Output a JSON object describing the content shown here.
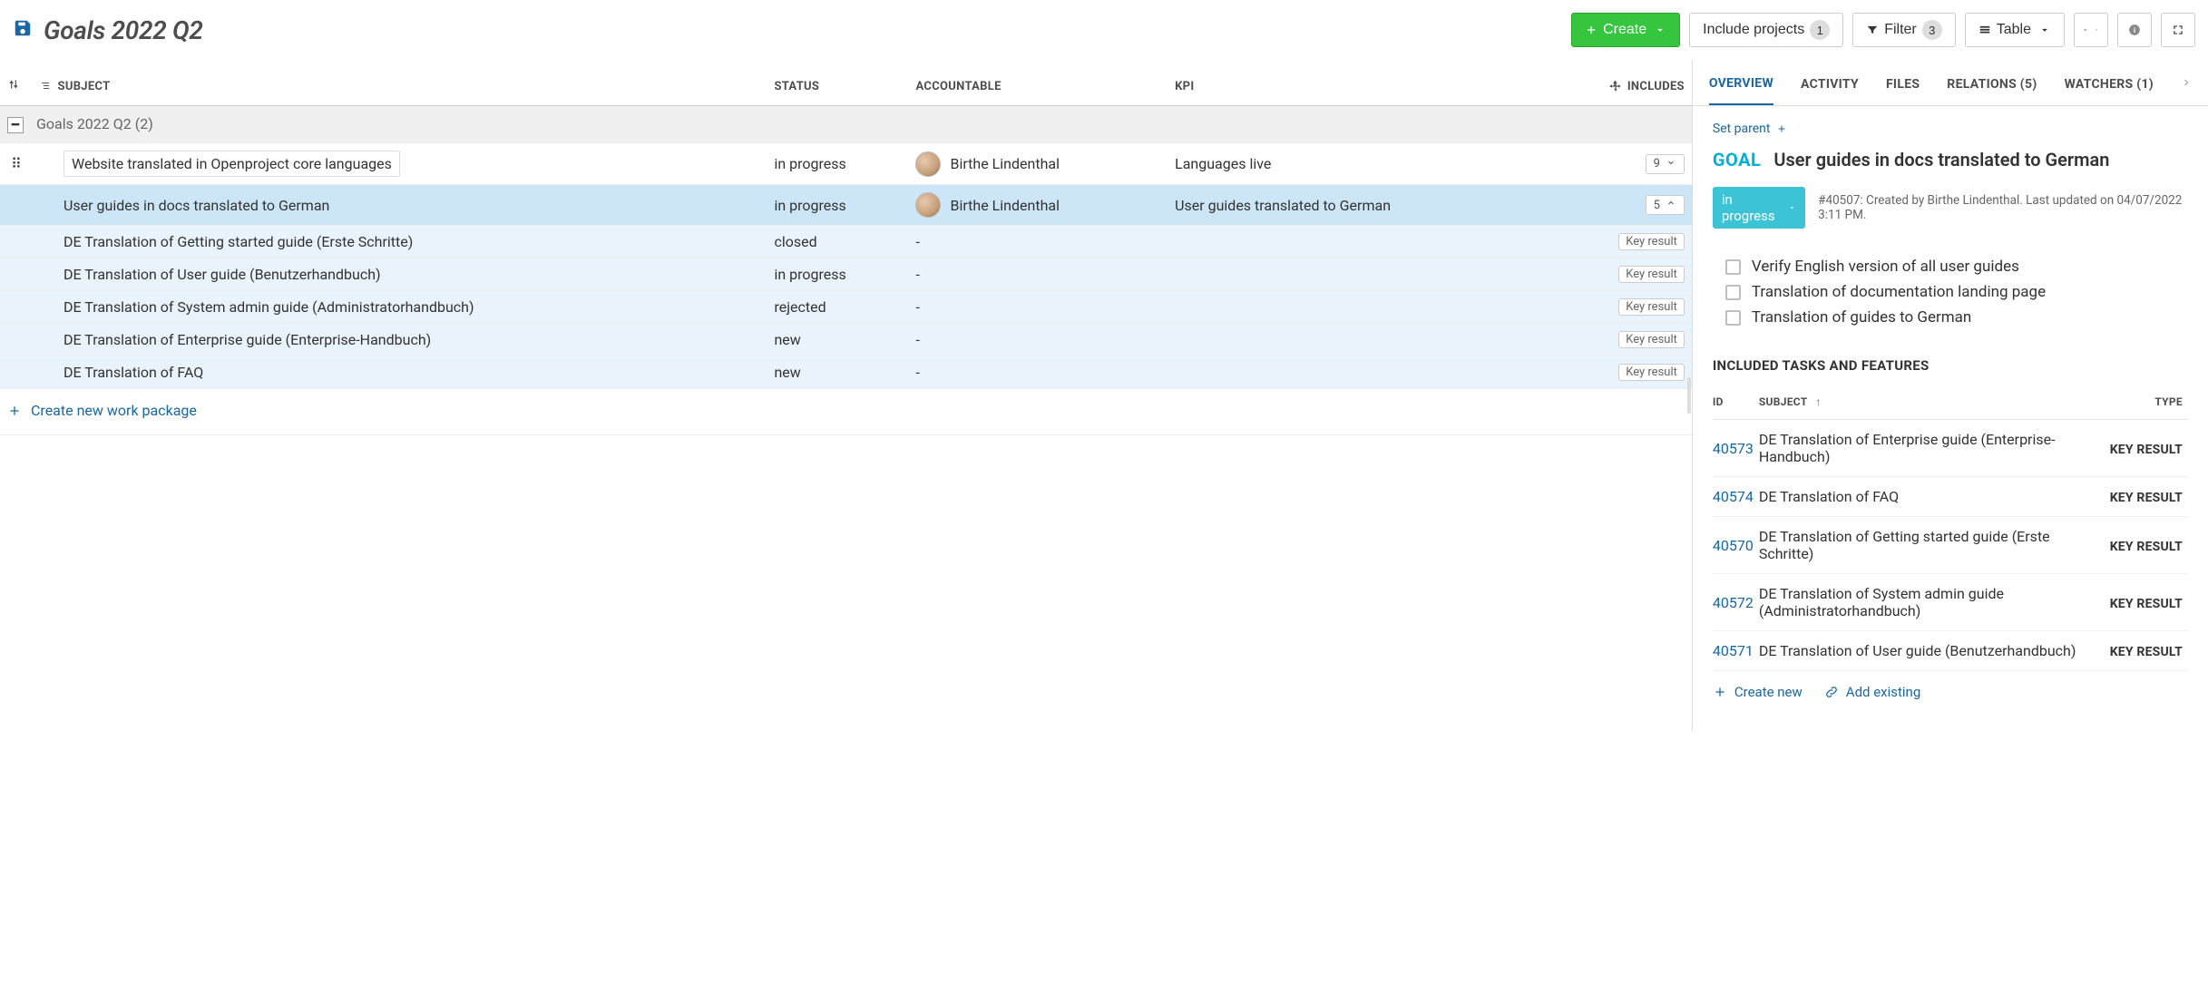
{
  "header": {
    "title": "Goals 2022 Q2",
    "create_label": "Create",
    "include_projects_label": "Include projects",
    "include_projects_count": "1",
    "filter_label": "Filter",
    "filter_count": "3",
    "view_label": "Table"
  },
  "table": {
    "columns": {
      "subject": "SUBJECT",
      "status": "STATUS",
      "accountable": "ACCOUNTABLE",
      "kpi": "KPI",
      "includes": "INCLUDES"
    },
    "group_label": "Goals 2022 Q2 (2)",
    "rows": [
      {
        "subject": "Website translated in Openproject core languages",
        "status": "in progress",
        "accountable": "Birthe Lindenthal",
        "has_avatar": true,
        "kpi": "Languages live",
        "includes": "9",
        "includes_open": false,
        "indent": 0,
        "selected": false,
        "tag": null
      },
      {
        "subject": "User guides in docs translated to German",
        "status": "in progress",
        "accountable": "Birthe Lindenthal",
        "has_avatar": true,
        "kpi": "User guides translated to German",
        "includes": "5",
        "includes_open": true,
        "indent": 0,
        "selected": true,
        "tag": null
      },
      {
        "subject": "DE Translation of Getting started guide (Erste Schritte)",
        "status": "closed",
        "accountable": "-",
        "has_avatar": false,
        "kpi": "",
        "includes": null,
        "includes_open": null,
        "indent": 1,
        "selected": false,
        "tag": "Key result"
      },
      {
        "subject": "DE Translation of User guide (Benutzerhandbuch)",
        "status": "in progress",
        "accountable": "-",
        "has_avatar": false,
        "kpi": "",
        "includes": null,
        "includes_open": null,
        "indent": 1,
        "selected": false,
        "tag": "Key result"
      },
      {
        "subject": "DE Translation of System admin guide (Administratorhandbuch)",
        "status": "rejected",
        "accountable": "-",
        "has_avatar": false,
        "kpi": "",
        "includes": null,
        "includes_open": null,
        "indent": 1,
        "selected": false,
        "tag": "Key result"
      },
      {
        "subject": "DE Translation of Enterprise guide (Enterprise-Handbuch)",
        "status": "new",
        "accountable": "-",
        "has_avatar": false,
        "kpi": "",
        "includes": null,
        "includes_open": null,
        "indent": 1,
        "selected": false,
        "tag": "Key result"
      },
      {
        "subject": "DE Translation of FAQ",
        "status": "new",
        "accountable": "-",
        "has_avatar": false,
        "kpi": "",
        "includes": null,
        "includes_open": null,
        "indent": 1,
        "selected": false,
        "tag": "Key result"
      }
    ],
    "create_new_label": "Create new work package"
  },
  "details": {
    "tabs": {
      "overview": "OVERVIEW",
      "activity": "ACTIVITY",
      "files": "FILES",
      "relations": "RELATIONS (5)",
      "watchers": "WATCHERS (1)"
    },
    "set_parent": "Set parent",
    "type": "GOAL",
    "title": "User guides in docs translated to German",
    "status": "in progress",
    "meta": "#40507: Created by Birthe Lindenthal. Last updated on 04/07/2022 3:11 PM.",
    "checklist": [
      "Verify English version of all user guides",
      "Translation of documentation landing page",
      "Translation of guides to German"
    ],
    "included_heading": "INCLUDED TASKS AND FEATURES",
    "included_columns": {
      "id": "ID",
      "subject": "SUBJECT",
      "type": "TYPE"
    },
    "included": [
      {
        "id": "40573",
        "subject": "DE Translation of Enterprise guide (Enterprise-Handbuch)",
        "type": "KEY RESULT"
      },
      {
        "id": "40574",
        "subject": "DE Translation of FAQ",
        "type": "KEY RESULT"
      },
      {
        "id": "40570",
        "subject": "DE Translation of Getting started guide (Erste Schritte)",
        "type": "KEY RESULT"
      },
      {
        "id": "40572",
        "subject": "DE Translation of System admin guide (Administratorhandbuch)",
        "type": "KEY RESULT"
      },
      {
        "id": "40571",
        "subject": "DE Translation of User guide (Benutzerhandbuch)",
        "type": "KEY RESULT"
      }
    ],
    "create_new": "Create new",
    "add_existing": "Add existing"
  }
}
